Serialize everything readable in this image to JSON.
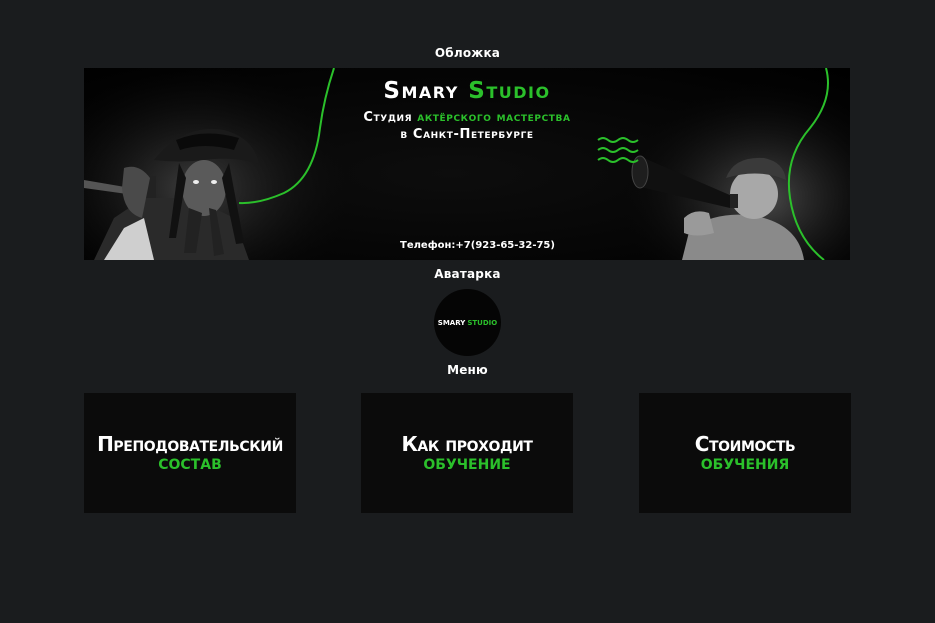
{
  "labels": {
    "cover": "Обложка",
    "avatar": "Аватарка",
    "menu": "Меню"
  },
  "cover": {
    "title_part1": "Smary",
    "title_part2": "Studio",
    "subtitle1_part1": "Студия",
    "subtitle1_part2": "актёрского мастерства",
    "subtitle2": "в Санкт-Петербурге",
    "phone": "Телефон:+7(923-65-32-75)"
  },
  "avatar": {
    "part1": "SMARY",
    "part2": "STUDIO"
  },
  "menu": [
    {
      "line1": "Преподовательский",
      "line2": "состав"
    },
    {
      "line1": "Как проходит",
      "line2": "обучение"
    },
    {
      "line1": "Стоимость",
      "line2": "обучения"
    }
  ],
  "colors": {
    "background": "#1a1c1e",
    "accent": "#2bc02b",
    "tile": "#0b0b0b"
  },
  "icons": {
    "left_figure": "pirate-photo",
    "right_figure": "boy-with-megaphone-photo",
    "sound_waves": "sound-wave-icon"
  }
}
